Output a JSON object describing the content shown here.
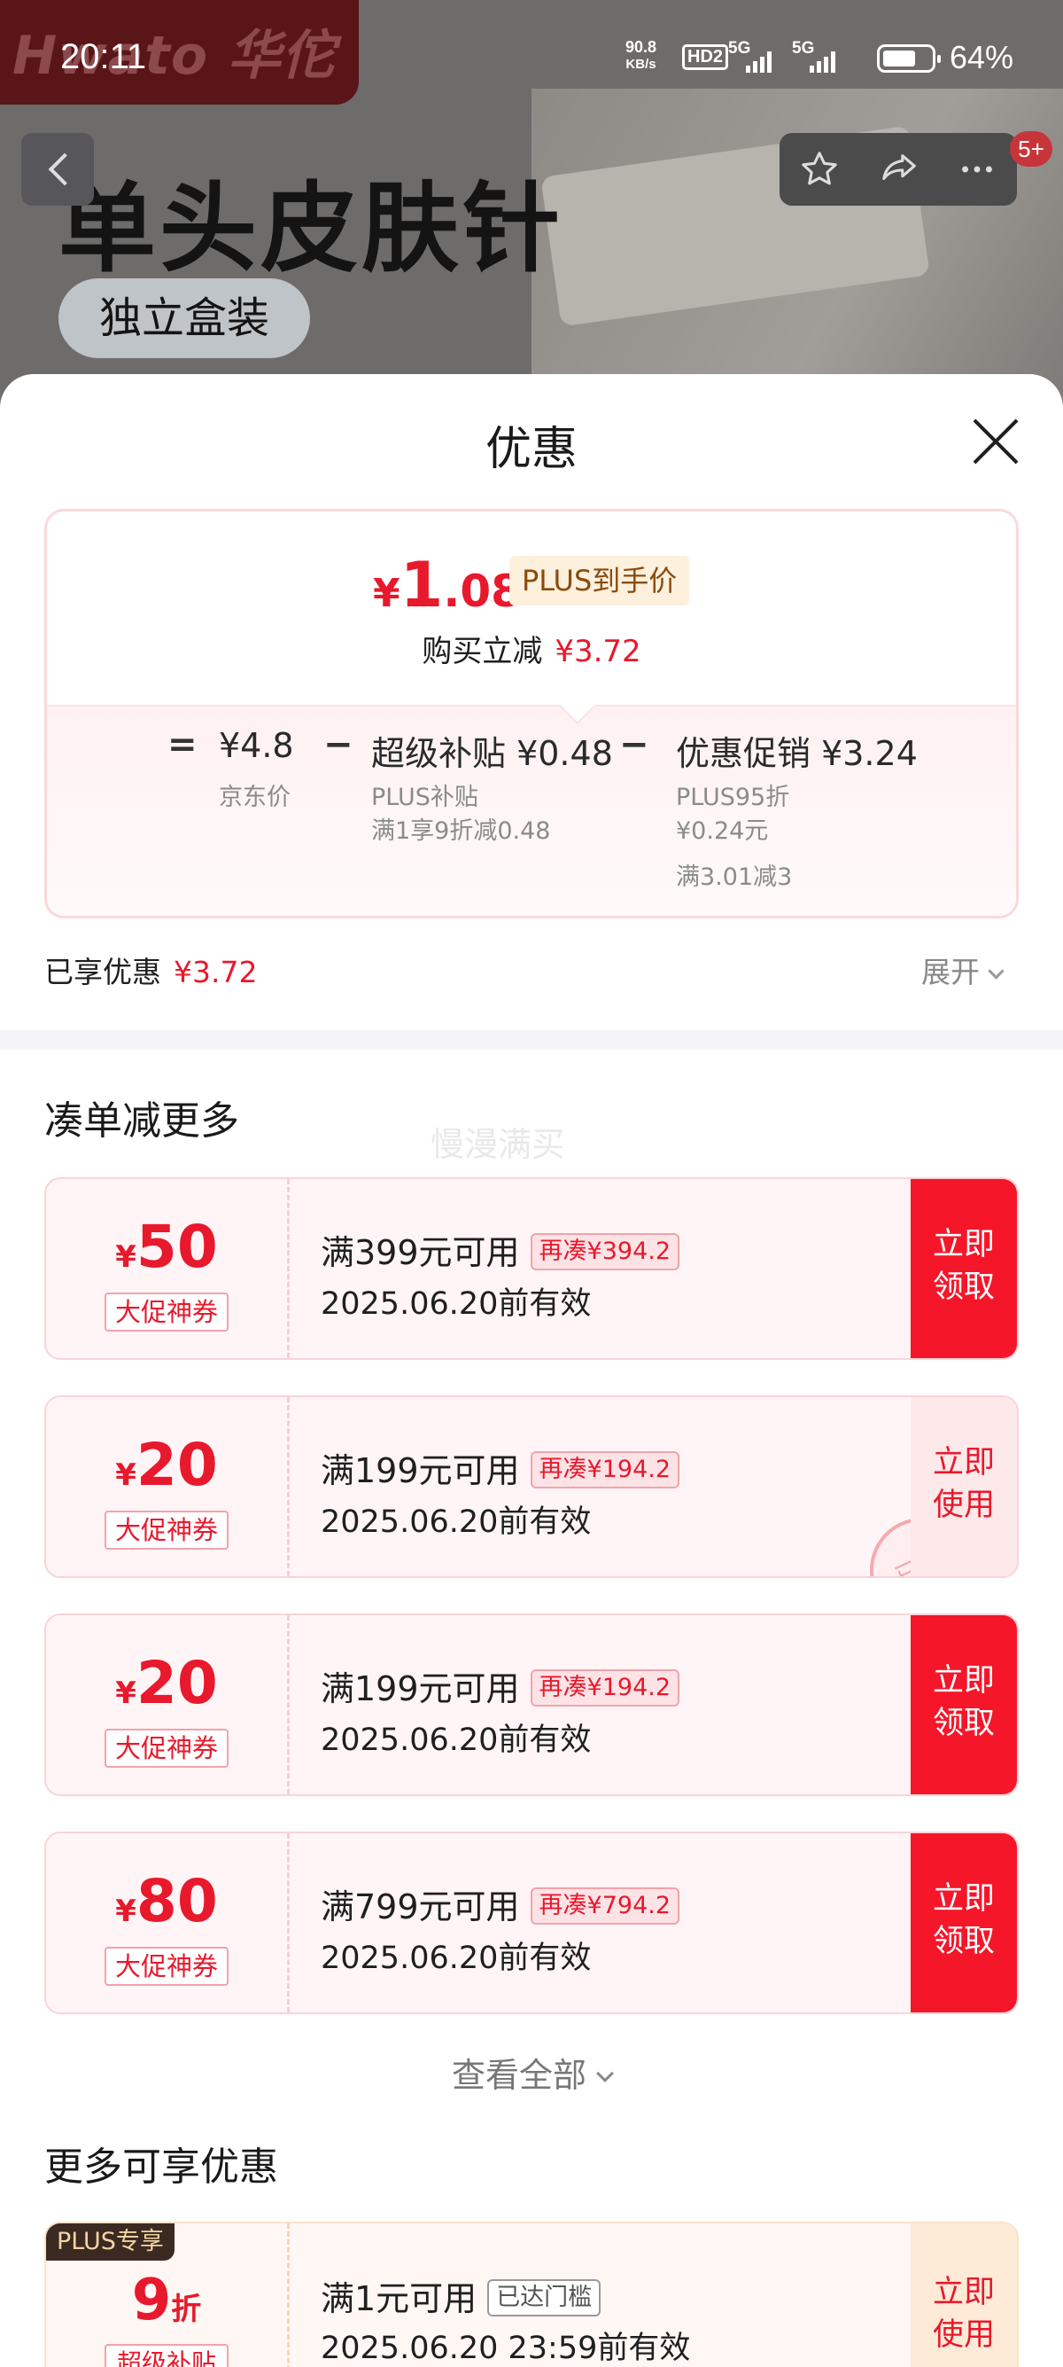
{
  "status_bar": {
    "time": "20:11",
    "net_speed": "90.8",
    "net_unit": "KB/s",
    "hd": "HD2",
    "sim1": "5G",
    "sim2": "5G",
    "battery": "64%"
  },
  "background": {
    "brand_logo_text": "Hwato 华佗",
    "product_title": "单头皮肤针",
    "product_pill": "独立盒装",
    "badge_count": "5+"
  },
  "sheet": {
    "title": "优惠",
    "price": {
      "yen": "¥",
      "integer": "1",
      "decimal": ".08",
      "plus_tag": "PLUS到手价",
      "reduce_label": "购买立减",
      "reduce_amount": "¥3.72"
    },
    "calc": {
      "equals": "=",
      "minus": "−",
      "jd_price": "¥4.8",
      "jd_price_label": "京东价",
      "subsidy_title": "超级补贴 ¥0.48",
      "subsidy_type": "PLUS补贴",
      "subsidy_rule": "满1享9折减0.48",
      "promo_title": "优惠促销 ¥3.24",
      "promo_line1": "PLUS95折",
      "promo_line2": "¥0.24元",
      "promo_line3": "满3.01减3"
    },
    "enjoyed_label": "已享优惠",
    "enjoyed_amount": "¥3.72",
    "expand_label": "展开",
    "section1_title": "凑单减更多",
    "watermark": "慢漫满买",
    "coupons": [
      {
        "yen": "¥",
        "amount": "50",
        "tag": "大促神券",
        "condition": "满399元可用",
        "more": "再凑¥394.2",
        "valid": "2025.06.20前有效",
        "button": "立即\n领取",
        "state": "unclaimed"
      },
      {
        "yen": "¥",
        "amount": "20",
        "tag": "大促神券",
        "condition": "满199元可用",
        "more": "再凑¥194.2",
        "valid": "2025.06.20前有效",
        "button": "立即\n使用",
        "state": "claimed",
        "stamp": "已领"
      },
      {
        "yen": "¥",
        "amount": "20",
        "tag": "大促神券",
        "condition": "满199元可用",
        "more": "再凑¥194.2",
        "valid": "2025.06.20前有效",
        "button": "立即\n领取",
        "state": "unclaimed"
      },
      {
        "yen": "¥",
        "amount": "80",
        "tag": "大促神券",
        "condition": "满799元可用",
        "more": "再凑¥794.2",
        "valid": "2025.06.20前有效",
        "button": "立即\n领取",
        "state": "unclaimed"
      }
    ],
    "view_all_label": "查看全部",
    "section2_title": "更多可享优惠",
    "plus_coupon": {
      "ribbon": "PLUS专享",
      "discount": "9",
      "unit": "折",
      "tag": "超级补贴",
      "condition": "满1元可用",
      "reached": "已达门槛",
      "valid": "2025.06.20 23:59前有效",
      "button": "立即\n使用"
    }
  },
  "colors": {
    "accent_red": "#e8192c",
    "button_red": "#f5162a",
    "plus_gold": "#8a4b0e"
  }
}
